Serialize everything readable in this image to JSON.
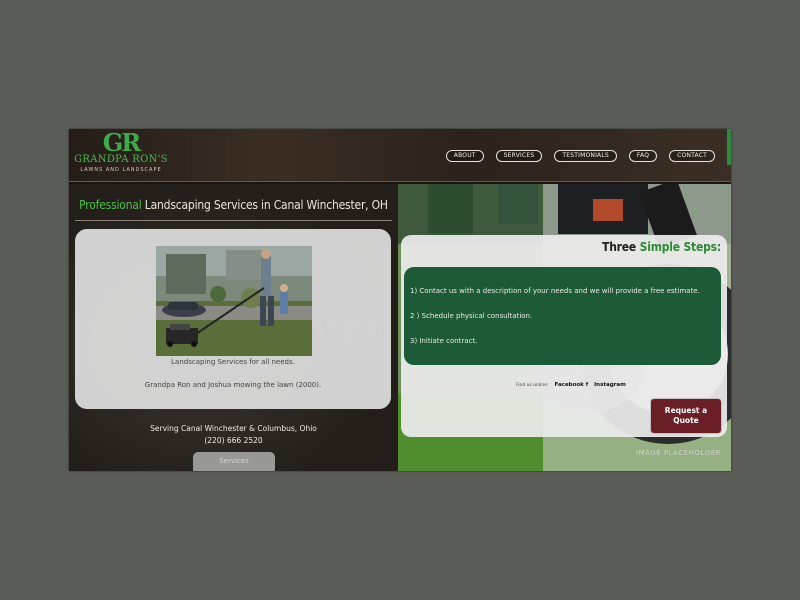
{
  "logo": {
    "monogram": "GR",
    "name": "GRANDPA RON'S",
    "tagline": "LAWNS AND LANDSCAPE"
  },
  "nav": {
    "items": [
      "ABOUT",
      "SERVICES",
      "TESTIMONIALS",
      "FAQ",
      "CONTACT"
    ]
  },
  "hero": {
    "headline_accent": "Professional",
    "headline_rest": " Landscaping Services in Canal Winchester, OH"
  },
  "photo_card": {
    "caption1": "Landscaping Services for all needs.",
    "caption2": "Grandpa Ron and Joshua mowing the lawn (2000)."
  },
  "serving": {
    "line1": "Serving Canal Winchester & Columbus, Ohio",
    "phone": "(220) 666 2520"
  },
  "services_button": "Services",
  "steps": {
    "title_plain": "Three ",
    "title_accent": "Simple Steps:",
    "items": [
      "1) Contact us with a description of your needs and we will provide a free estimate.",
      "2 ) Schedule physical consultation.",
      "3) Initiate contract."
    ]
  },
  "social": {
    "find": "Find us online:",
    "facebook": "Facebook f",
    "instagram": "Instagram"
  },
  "quote_button": "Request a Quote",
  "image_placeholder": "IMAGE PLACEHOLDER",
  "colors": {
    "accent_green": "#4bbf46",
    "steps_green": "#1d5a37",
    "quote_red": "#6a1e26"
  }
}
